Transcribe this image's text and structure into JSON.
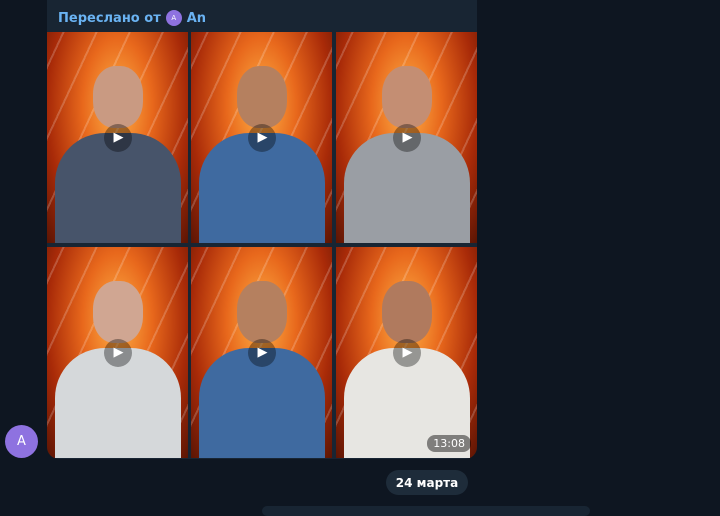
{
  "message": {
    "forwarded_prefix": "Переслано от",
    "forwarded_avatar_letter": "A",
    "forwarded_from": "An",
    "sender_avatar_letter": "A",
    "videos": [
      {
        "play_icon": "▶",
        "head": "#c99a82",
        "body": "#47546a"
      },
      {
        "play_icon": "▶",
        "head": "#b5805f",
        "body": "#3f6aa0"
      },
      {
        "play_icon": "▶",
        "head": "#c48e73",
        "body": "#9a9ea4"
      },
      {
        "play_icon": "▶",
        "head": "#d0a692",
        "body": "#d5d8da"
      },
      {
        "play_icon": "▶",
        "head": "#b5805f",
        "body": "#3f6aa0"
      },
      {
        "play_icon": "▶",
        "head": "#b07a5e",
        "body": "#e7e6e2",
        "duration": "13:08"
      }
    ]
  },
  "date_separator": "24 марта",
  "colors": {
    "background": "#0e1621",
    "bubble": "#182533",
    "accent": "#6ab3f3",
    "avatar": "#8e72e0"
  }
}
